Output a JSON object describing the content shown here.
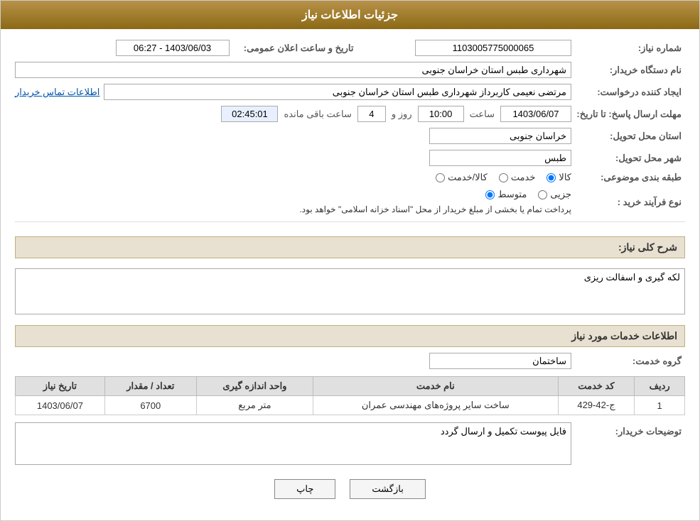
{
  "header": {
    "title": "جزئیات اطلاعات نیاز"
  },
  "fields": {
    "need_number_label": "شماره نیاز:",
    "need_number_value": "1103005775000065",
    "announce_label": "تاریخ و ساعت اعلان عمومی:",
    "announce_value": "1403/06/03 - 06:27",
    "buyer_org_label": "نام دستگاه خریدار:",
    "buyer_org_value": "شهرداری طبس استان خراسان جنوبی",
    "creator_label": "ایجاد کننده درخواست:",
    "creator_value": "مرتضی نعیمی کاربرداز شهرداری طبس استان خراسان جنوبی",
    "contact_link": "اطلاعات تماس خریدار",
    "response_deadline_label": "مهلت ارسال پاسخ: تا تاریخ:",
    "response_date": "1403/06/07",
    "response_time_label": "ساعت",
    "response_time": "10:00",
    "response_days_label": "روز و",
    "response_days": "4",
    "remaining_label": "ساعت باقی مانده",
    "remaining_time": "02:45:01",
    "province_label": "استان محل تحویل:",
    "province_value": "خراسان جنوبی",
    "city_label": "شهر محل تحویل:",
    "city_value": "طبس",
    "category_label": "طبقه بندی موضوعی:",
    "category_options": [
      "کالا",
      "خدمت",
      "کالا/خدمت"
    ],
    "category_selected": "کالا",
    "process_label": "نوع فرآیند خرید :",
    "process_options": [
      "جزیی",
      "متوسط"
    ],
    "process_selected": "متوسط",
    "process_text": "پرداخت تمام یا بخشی از مبلغ خریدار از محل \"اسناد خزانه اسلامی\" خواهد بود.",
    "description_label": "شرح کلی نیاز:",
    "description_value": "لکه گیری و اسفالت ریزی",
    "services_section": "اطلاعات خدمات مورد نیاز",
    "service_group_label": "گروه خدمت:",
    "service_group_value": "ساختمان",
    "table": {
      "headers": [
        "ردیف",
        "کد خدمت",
        "نام خدمت",
        "واحد اندازه گیری",
        "تعداد / مقدار",
        "تاریخ نیاز"
      ],
      "rows": [
        {
          "row": "1",
          "code": "ج-42-429",
          "name": "ساخت سایر پروژه‌های مهندسی عمران",
          "unit": "متر مربع",
          "quantity": "6700",
          "date": "1403/06/07"
        }
      ]
    },
    "buyer_notes_label": "توضیحات خریدار:",
    "buyer_notes_value": "فایل پیوست تکمیل و ارسال گردد"
  },
  "buttons": {
    "print": "چاپ",
    "back": "بازگشت"
  }
}
